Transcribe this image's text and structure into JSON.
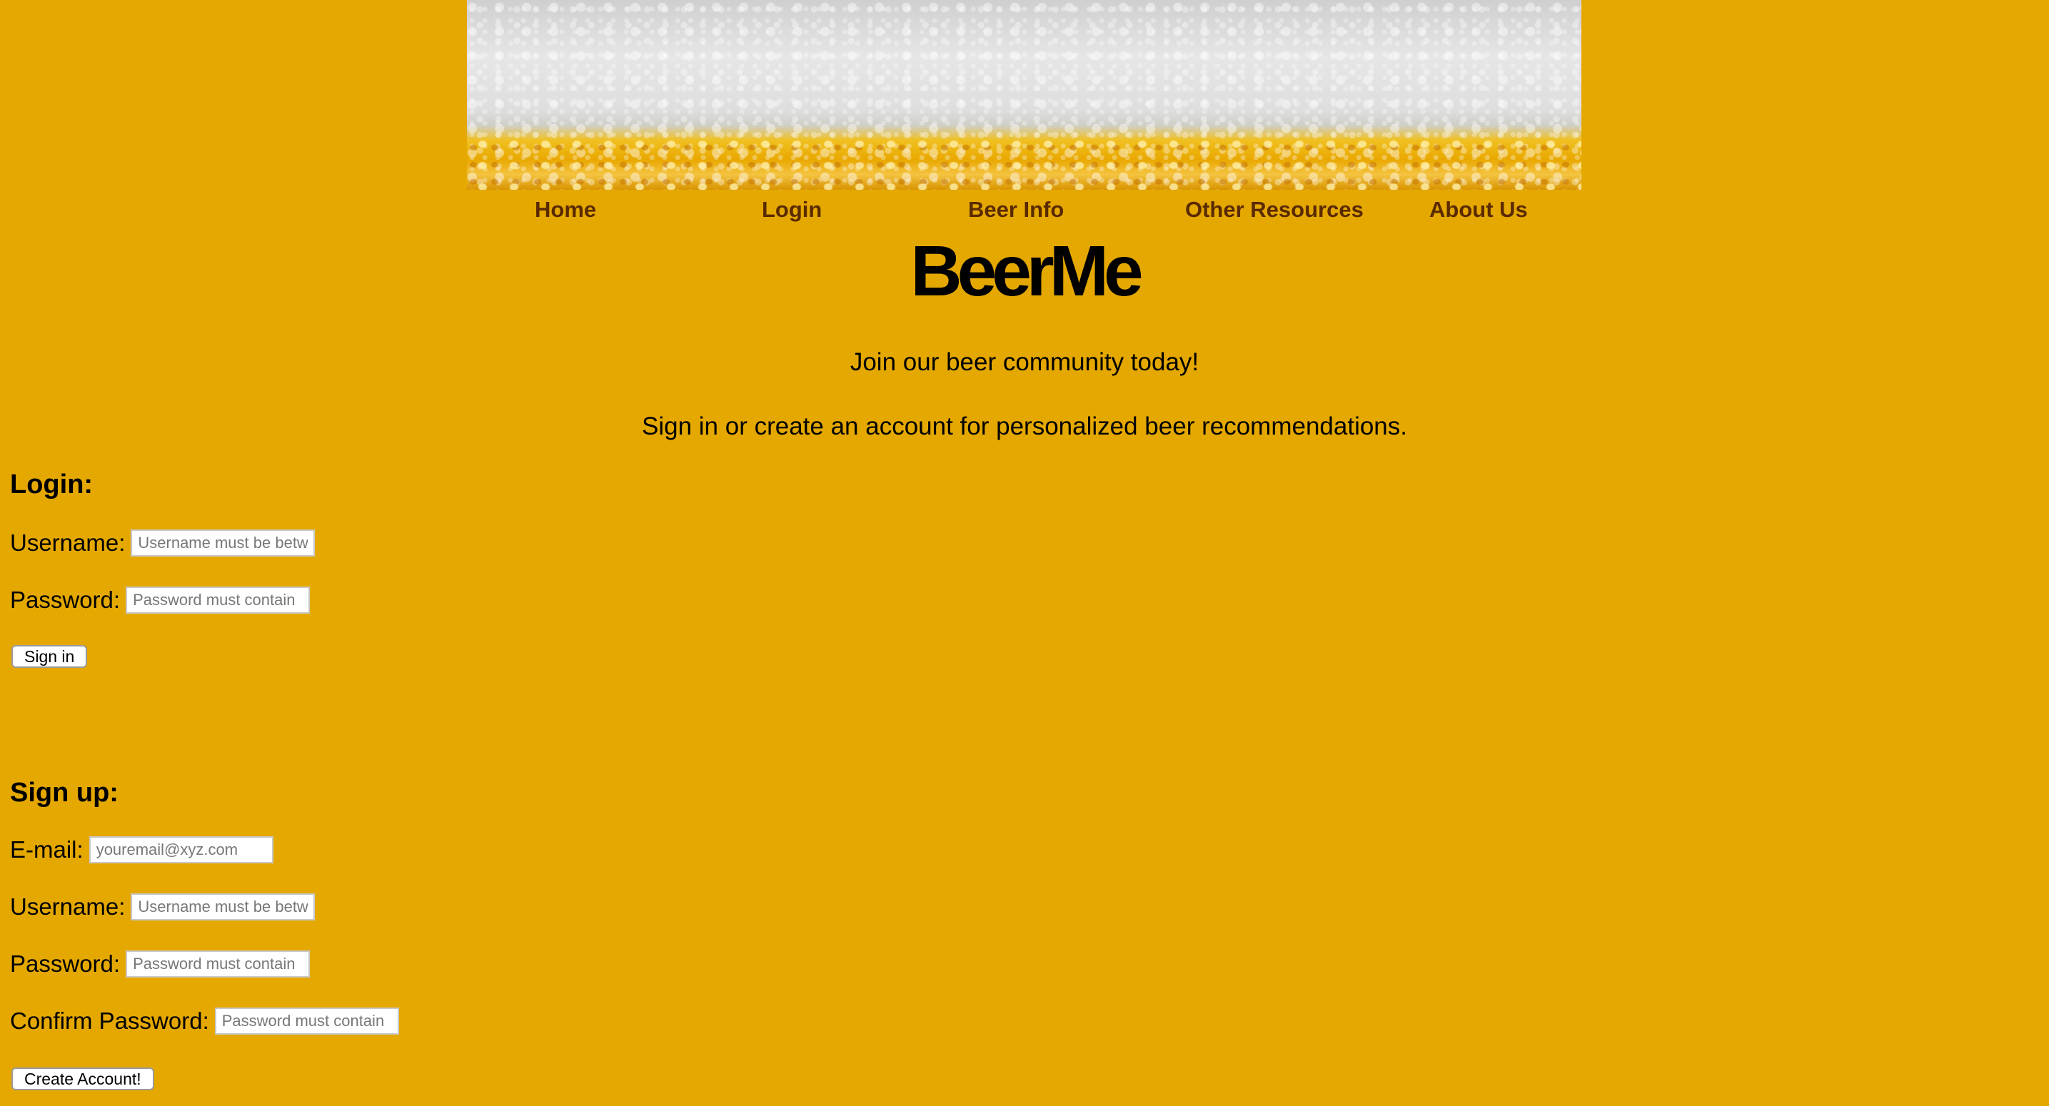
{
  "nav": {
    "items": [
      {
        "label": "Home"
      },
      {
        "label": "Login"
      },
      {
        "label": "Beer Info"
      },
      {
        "label": "Other Resources"
      },
      {
        "label": "About Us"
      }
    ]
  },
  "site_title": "BeerMe",
  "intro": {
    "tagline": "Join our beer community today!",
    "subtext": "Sign in or create an account for personalized beer recommendations."
  },
  "login": {
    "heading": "Login:",
    "username_label": "Username:",
    "username_placeholder": "Username must be between",
    "password_label": "Password:",
    "password_placeholder": "Password must contain",
    "submit_label": "Sign in"
  },
  "signup": {
    "heading": "Sign up:",
    "email_label": "E-mail:",
    "email_placeholder": "youremail@xyz.com",
    "username_label": "Username:",
    "username_placeholder": "Username must be between",
    "password_label": "Password:",
    "password_placeholder": "Password must contain",
    "confirm_label": "Confirm Password:",
    "confirm_placeholder": "Password must contain",
    "submit_label": "Create Account!"
  },
  "colors": {
    "background": "#e5a800",
    "nav_text": "#5a2a00"
  }
}
